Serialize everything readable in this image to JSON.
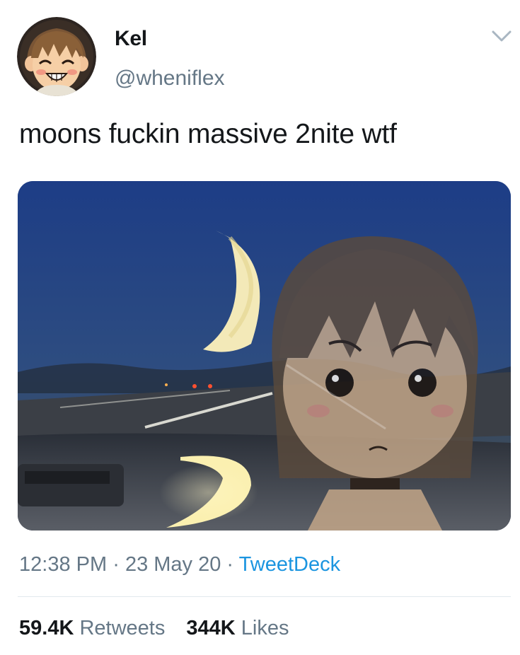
{
  "user": {
    "display_name": "Kel",
    "handle": "@wheniflex",
    "avatar_icon": "cartoon-avatar-icon"
  },
  "tweet": {
    "text": "moons fuckin massive 2nite wtf",
    "time": "12:38 PM",
    "separator": "·",
    "date": "23 May 20",
    "source": "TweetDeck"
  },
  "stats": {
    "retweets_count": "59.4K",
    "retweets_label": "Retweets",
    "likes_count": "344K",
    "likes_label": "Likes"
  },
  "colors": {
    "text": "#14171a",
    "secondary": "#657786",
    "link": "#1b95e0",
    "divider": "#e1e8ed"
  }
}
